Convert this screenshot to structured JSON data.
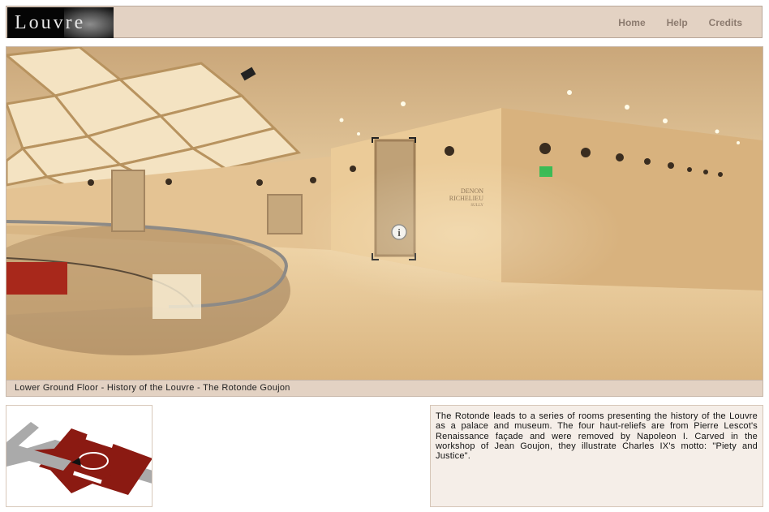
{
  "header": {
    "logo_text": "Louvre",
    "nav": [
      "Home",
      "Help",
      "Credits"
    ]
  },
  "panorama": {
    "caption": "Lower Ground Floor - History of the Louvre - The Rotonde Goujon",
    "wall_sign_lines": [
      "DENON",
      "RICHELIEU",
      "SULLY"
    ],
    "info_icon": "info-icon"
  },
  "description": {
    "text": "The Rotonde leads to a series of rooms presenting the history of the Louvre as a palace and museum. The four haut-reliefs are from Pierre Lescot's Renaissance façade and were removed by Napoleon I. Carved in the workshop of Jean Goujon, they illustrate Charles IX's motto: \"Piety and Justice\"."
  },
  "colors": {
    "header_bg": "#e3d2c3",
    "nav_text": "#8c7b6f",
    "map_red": "#8b1a12",
    "map_gray": "#aaaaaa",
    "desc_bg": "#f5eee8"
  }
}
